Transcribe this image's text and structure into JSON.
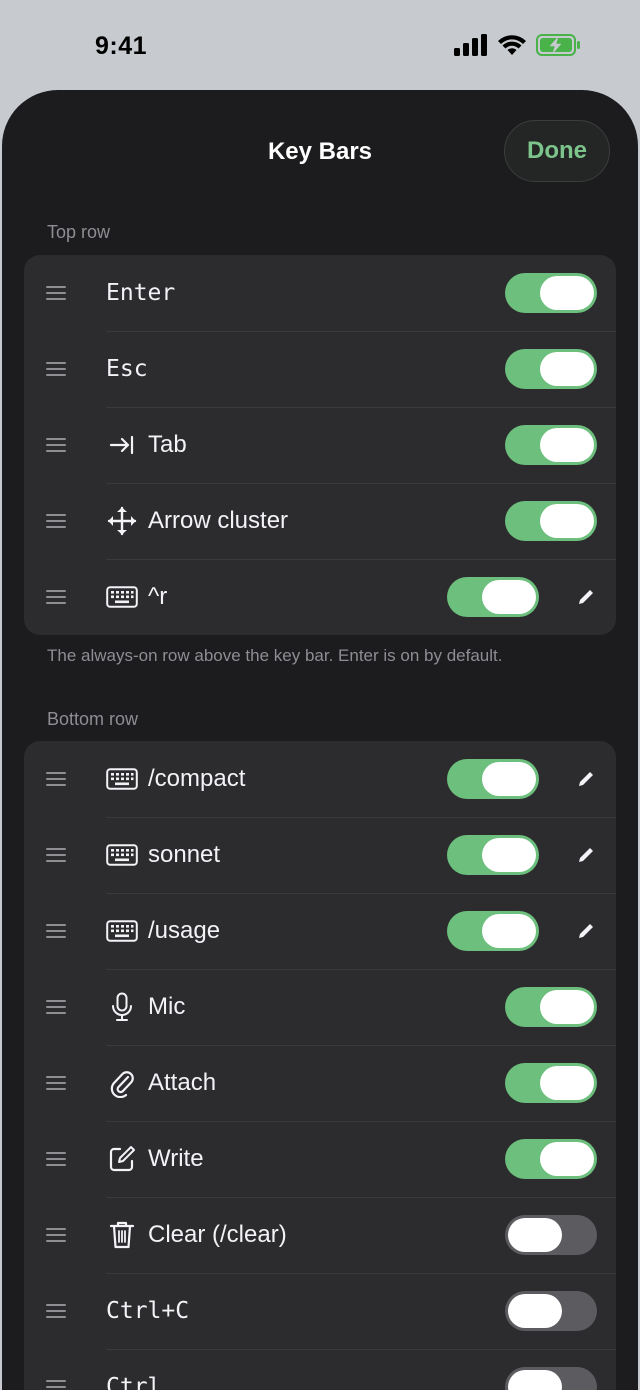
{
  "status_bar": {
    "time": "9:41",
    "icons": [
      "signal-icon",
      "wifi-icon",
      "battery-charging-icon"
    ]
  },
  "header": {
    "title": "Key Bars",
    "done_label": "Done"
  },
  "top_row": {
    "label": "Top row",
    "footnote": "The always-on row above the key bar. Enter is on by default.",
    "items": [
      {
        "label": "Enter",
        "icon": "",
        "enabled": true,
        "editable": false
      },
      {
        "label": "Esc",
        "icon": "",
        "enabled": true,
        "editable": false
      },
      {
        "label": "Tab",
        "icon": "tab-arrow-icon",
        "enabled": true,
        "editable": false
      },
      {
        "label": "Arrow cluster",
        "icon": "move-arrows-icon",
        "enabled": true,
        "editable": false
      },
      {
        "label": "^r",
        "icon": "keyboard-icon",
        "enabled": true,
        "editable": true
      }
    ]
  },
  "bottom_row": {
    "label": "Bottom row",
    "items": [
      {
        "label": "/compact",
        "icon": "keyboard-icon",
        "enabled": true,
        "editable": true
      },
      {
        "label": "sonnet",
        "icon": "keyboard-icon",
        "enabled": true,
        "editable": true
      },
      {
        "label": "/usage",
        "icon": "keyboard-icon",
        "enabled": true,
        "editable": true
      },
      {
        "label": "Mic",
        "icon": "mic-icon",
        "enabled": true,
        "editable": false
      },
      {
        "label": "Attach",
        "icon": "paperclip-icon",
        "enabled": true,
        "editable": false
      },
      {
        "label": "Write",
        "icon": "compose-icon",
        "enabled": true,
        "editable": false
      },
      {
        "label": "Clear (/clear)",
        "icon": "trash-icon",
        "enabled": false,
        "editable": false
      },
      {
        "label": "Ctrl+C",
        "icon": "",
        "enabled": false,
        "editable": false
      },
      {
        "label": "Ctrl",
        "icon": "",
        "enabled": false,
        "editable": false
      }
    ]
  },
  "colors": {
    "accent": "#6cbf7c",
    "done_text": "#7cc48b",
    "sheet_bg": "#1c1c1e",
    "group_bg": "#2c2c2e"
  }
}
